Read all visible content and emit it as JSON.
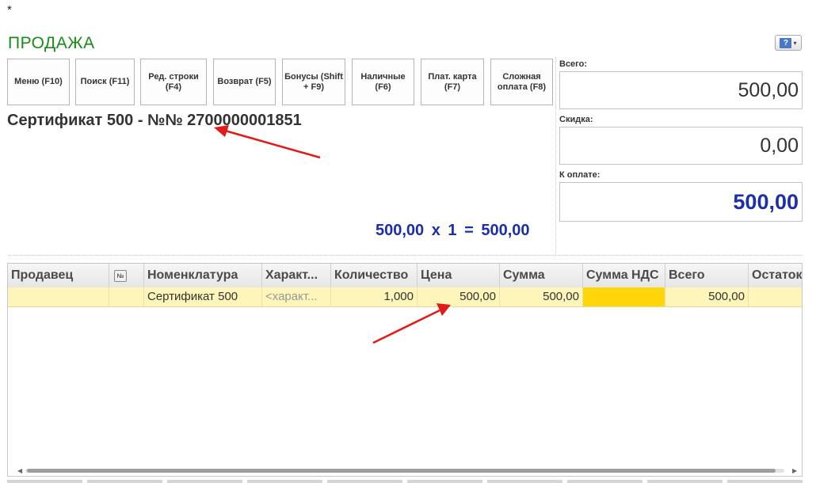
{
  "window": {
    "modified_mark": "*",
    "title": "ПРОДАЖА"
  },
  "help": {
    "icon": "help-book-icon",
    "glyph": "?",
    "caret": "▾"
  },
  "toolbar": [
    {
      "label": "Меню (F10)"
    },
    {
      "label": "Поиск (F11)"
    },
    {
      "label": "Ред. строки (F4)"
    },
    {
      "label": "Возврат (F5)"
    },
    {
      "label": "Бонусы (Shift + F9)"
    },
    {
      "label": "Наличные (F6)"
    },
    {
      "label": "Плат. карта (F7)"
    },
    {
      "label": "Сложная оплата (F8)"
    }
  ],
  "item": {
    "title": "Сертификат 500 - №№ 2700000001851",
    "calc": "500,00  x 1  = 500,00"
  },
  "totals": {
    "total_label": "Всего:",
    "total_value": "500,00",
    "discount_label": "Скидка:",
    "discount_value": "0,00",
    "pay_label": "К оплате:",
    "pay_value": "500,00"
  },
  "table": {
    "columns": [
      "Продавец",
      "№",
      "Номенклатура",
      "Характ...",
      "Количество",
      "Цена",
      "Сумма",
      "Сумма НДС",
      "Всего",
      "Остаток"
    ],
    "rows": [
      {
        "seller": "",
        "no": "",
        "name": "Сертификат 500",
        "characteristic": "<характ...",
        "qty": "1,000",
        "price": "500,00",
        "sum": "500,00",
        "vat": "",
        "total": "500,00",
        "rest": ""
      }
    ]
  },
  "colors": {
    "title_green": "#1a8a1a",
    "accent_blue": "#1c2ea8",
    "row_highlight": "#fdf5b9",
    "vat_cell": "#ffd60a",
    "arrow_red": "#e01b1b"
  }
}
